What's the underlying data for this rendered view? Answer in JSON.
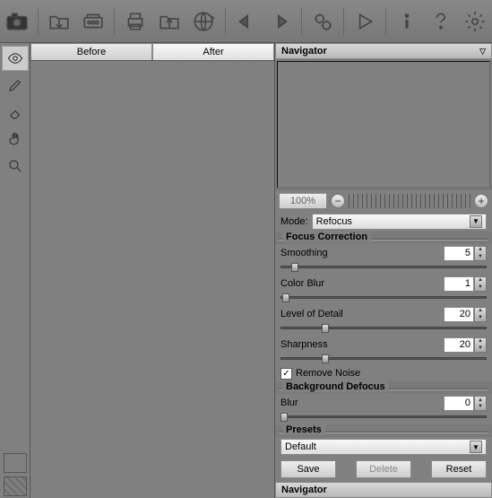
{
  "toolbar": {
    "icons": [
      "camera",
      "open",
      "batch",
      "print",
      "save",
      "web",
      "undo",
      "redo",
      "gears",
      "play",
      "info",
      "help",
      "settings"
    ]
  },
  "sidebar": {
    "tools": [
      "eye",
      "pencil",
      "eraser",
      "hand",
      "zoom"
    ]
  },
  "tabs": {
    "before": "Before",
    "after": "After"
  },
  "right": {
    "navigator_title": "Navigator",
    "zoom": "100%",
    "mode_label": "Mode:",
    "mode_value": "Refocus",
    "group_focus": "Focus Correction",
    "smoothing_label": "Smoothing",
    "smoothing_value": "5",
    "colorblur_label": "Color Blur",
    "colorblur_value": "1",
    "lod_label": "Level of Detail",
    "lod_value": "20",
    "sharpness_label": "Sharpness",
    "sharpness_value": "20",
    "remove_noise_label": "Remove Noise",
    "group_bg": "Background Defocus",
    "blur_label": "Blur",
    "blur_value": "0",
    "group_presets": "Presets",
    "preset_value": "Default",
    "save_btn": "Save",
    "delete_btn": "Delete",
    "reset_btn": "Reset",
    "navigator2_title": "Navigator"
  }
}
